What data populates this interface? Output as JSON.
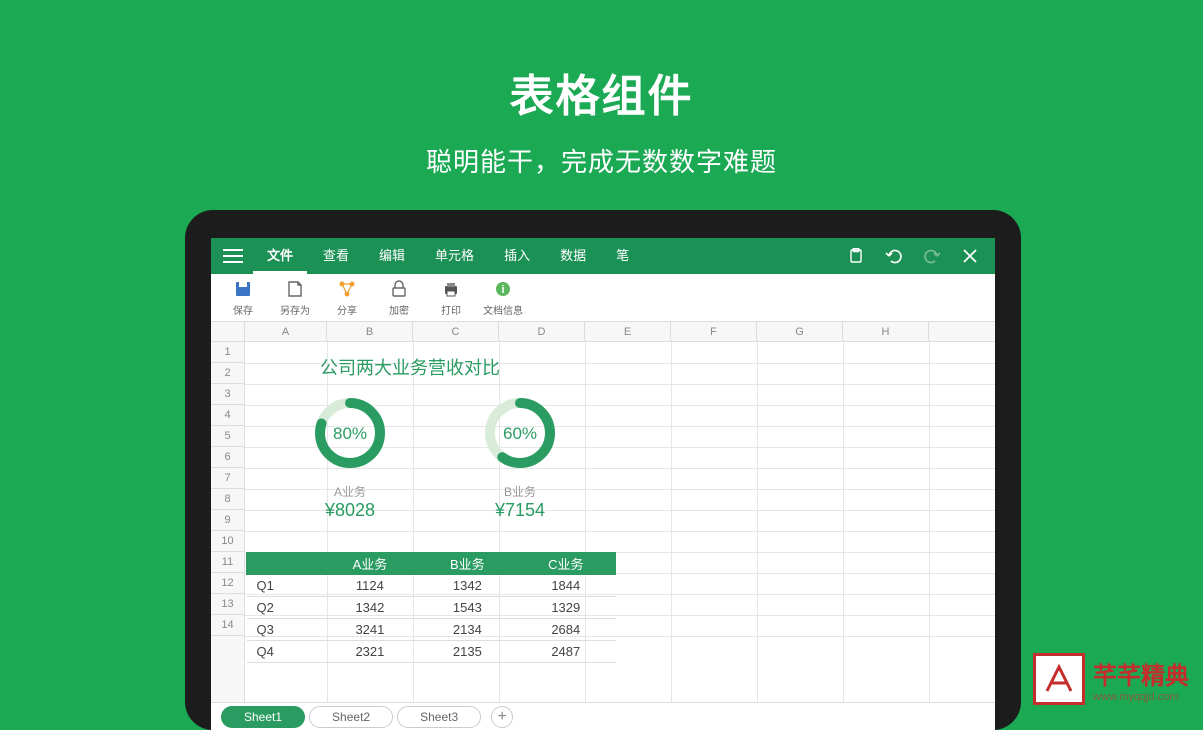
{
  "headline": {
    "title": "表格组件",
    "subtitle": "聪明能干，完成无数数字难题"
  },
  "menubar": {
    "tabs": [
      "文件",
      "查看",
      "编辑",
      "单元格",
      "插入",
      "数据",
      "笔"
    ],
    "active_index": 0
  },
  "toolbar": {
    "items": [
      "保存",
      "另存为",
      "分享",
      "加密",
      "打印",
      "文档信息"
    ]
  },
  "columns": [
    "A",
    "B",
    "C",
    "D",
    "E",
    "F",
    "G",
    "H"
  ],
  "row_count": 14,
  "chart_data": {
    "title": "公司两大业务营收对比",
    "donuts": [
      {
        "label": "A业务",
        "percent": 80,
        "value": "¥8028"
      },
      {
        "label": "B业务",
        "percent": 60,
        "value": "¥7154"
      }
    ],
    "table": {
      "headers": [
        "",
        "A业务",
        "B业务",
        "C业务"
      ],
      "rows": [
        [
          "Q1",
          1124,
          1342,
          1844
        ],
        [
          "Q2",
          1342,
          1543,
          1329
        ],
        [
          "Q3",
          3241,
          2134,
          2684
        ],
        [
          "Q4",
          2321,
          2135,
          2487
        ]
      ]
    }
  },
  "sheets": {
    "items": [
      "Sheet1",
      "Sheet2",
      "Sheet3"
    ],
    "active_index": 0
  },
  "watermark": {
    "text": "芊芊精典",
    "sub": "www.myqqjd.com"
  }
}
